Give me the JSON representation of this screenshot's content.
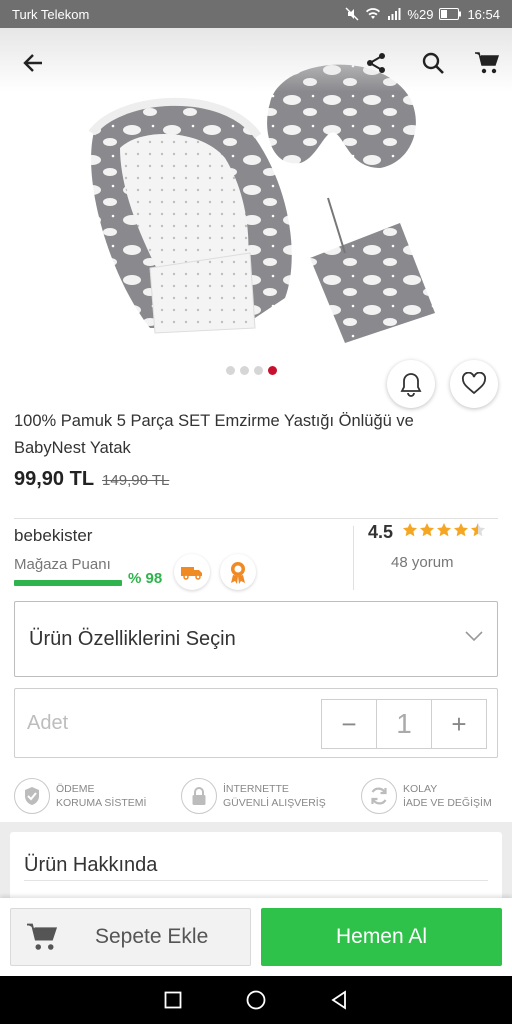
{
  "status_bar": {
    "carrier": "Turk Telekom",
    "battery": "%29",
    "time": "16:54"
  },
  "product": {
    "title": "100% Pamuk  5 Parça SET Emzirme Yastığı Önlüğü ve BabyNest Yatak",
    "price": "99,90 TL",
    "old_price": "149,90 TL",
    "image_count": 4,
    "active_image_index": 3
  },
  "seller": {
    "name": "bebekister",
    "store_score_label": "Mağaza Puanı",
    "store_score": "% 98",
    "store_score_fraction": 0.98,
    "rating": "4.5",
    "rating_value": 4.5,
    "reviews": "48 yorum"
  },
  "options": {
    "select_label": "Ürün Özelliklerini Seçin"
  },
  "quantity": {
    "label": "Adet",
    "value": "1",
    "minus": "−",
    "plus": "+"
  },
  "trust": [
    {
      "line1": "ÖDEME",
      "line2": "KORUMA SİSTEMİ",
      "icon": "shield-check-icon"
    },
    {
      "line1": "İNTERNETTE",
      "line2": "GÜVENLİ ALIŞVERİŞ",
      "icon": "lock-icon"
    },
    {
      "line1": "KOLAY",
      "line2": "İADE VE DEĞİŞİM",
      "icon": "refresh-icon"
    }
  ],
  "about": {
    "title": "Ürün Hakkında"
  },
  "actions": {
    "add_to_cart": "Sepete Ekle",
    "buy_now": "Hemen Al"
  },
  "colors": {
    "brand_green": "#2fc24a",
    "score_green": "#2fb34d",
    "active_dot": "#c8102e",
    "star": "#f5a623"
  }
}
